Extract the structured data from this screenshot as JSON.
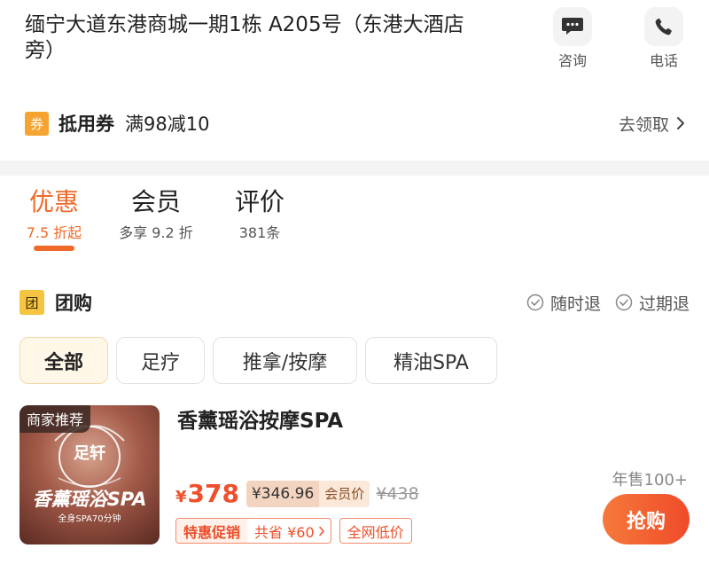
{
  "shop": {
    "address_line1": "缅宁大道东港商城一期1栋 A205号（东港大酒店",
    "address_line2": "旁）",
    "consult_label": "咨询",
    "phone_label": "电话"
  },
  "coupon": {
    "badge": "券",
    "title": "抵用券",
    "desc": "满98减10",
    "action": "去领取"
  },
  "tabs": [
    {
      "title": "优惠",
      "sub": "7.5 折起",
      "active": true
    },
    {
      "title": "会员",
      "sub": "多享 9.2 折",
      "active": false
    },
    {
      "title": "评价",
      "sub": "381条",
      "active": false
    }
  ],
  "group": {
    "badge": "团",
    "title": "团购",
    "policies": [
      "随时退",
      "过期退"
    ]
  },
  "filters": [
    "全部",
    "足疗",
    "推拿/按摩",
    "精油SPA"
  ],
  "deal": {
    "tag": "商家推荐",
    "image_text_top": "足轩",
    "image_text_main": "香薰瑶浴SPA",
    "image_text_sub": "全身SPA70分钟",
    "title": "香薰瑶浴按摩SPA",
    "currency": "¥",
    "price": "378",
    "member_price": "¥346.96",
    "member_label": "会员价",
    "original_price": "¥438",
    "sold": "年售100+",
    "promo_lead": "特惠促销",
    "promo_saving": "共省 ¥60",
    "promo_lowest": "全网低价",
    "buy_label": "抢购"
  },
  "colors": {
    "accent": "#ef6a2a",
    "coupon_badge": "#f5a431",
    "group_badge": "#f5c542"
  }
}
